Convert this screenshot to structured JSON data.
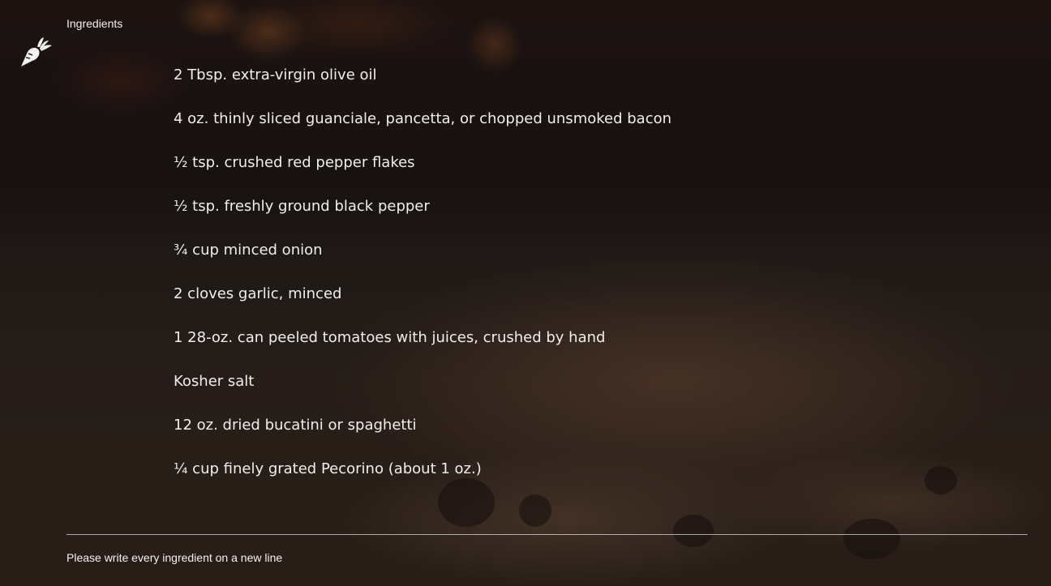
{
  "field": {
    "label": "Ingredients",
    "hint": "Please write every ingredient on a new line"
  },
  "logo": {
    "icon": "carrot-icon",
    "color": "#f2f2f2"
  },
  "ingredients": [
    "2 Tbsp. extra-virgin olive oil",
    "4 oz. thinly sliced guanciale, pancetta, or chopped unsmoked bacon",
    "½ tsp. crushed red pepper flakes",
    "½ tsp. freshly ground black pepper",
    "¾ cup minced onion",
    "2 cloves garlic, minced",
    "1 28-oz. can peeled tomatoes with juices, crushed by hand",
    "Kosher salt",
    "12 oz. dried bucatini or spaghetti",
    "¼ cup finely grated Pecorino (about 1 oz.)"
  ]
}
